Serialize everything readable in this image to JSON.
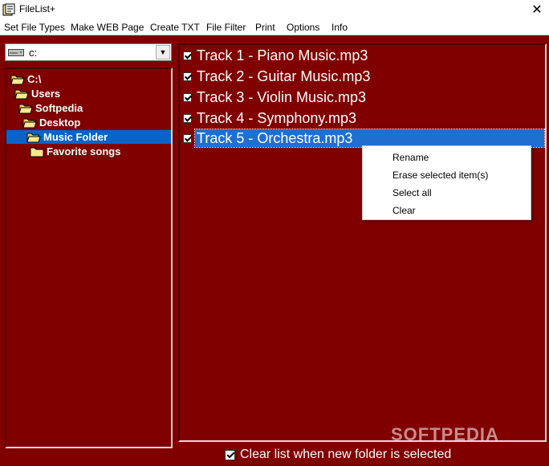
{
  "window": {
    "title": "FileList+"
  },
  "menu": {
    "items": [
      "Set File Types",
      "Make WEB Page",
      "Create TXT",
      "File Filter",
      "Print",
      "Options",
      "Info"
    ]
  },
  "drive": {
    "value": "c:"
  },
  "tree": {
    "nodes": [
      "C:\\",
      "Users",
      "Softpedia",
      "Desktop",
      "Music Folder",
      "Favorite songs"
    ],
    "selected": "Music Folder"
  },
  "files": [
    {
      "name": "Track 1 - Piano Music.mp3",
      "checked": true
    },
    {
      "name": "Track 2 - Guitar Music.mp3",
      "checked": true
    },
    {
      "name": "Track 3 - Violin Music.mp3",
      "checked": true
    },
    {
      "name": "Track 4 - Symphony.mp3",
      "checked": true
    },
    {
      "name": "Track 5 - Orchestra.mp3",
      "checked": true
    }
  ],
  "context_menu": {
    "items": [
      "Rename",
      "Erase selected item(s)",
      "Select all",
      "Clear"
    ]
  },
  "options": {
    "clear_list_label": "Clear list when new folder is selected",
    "clear_list_checked": true
  },
  "watermark": "SOFTPEDIA",
  "colors": {
    "background": "#800000",
    "selection": "#0a64c8"
  },
  "icons": [
    "app-icon",
    "close-icon",
    "drive-icon",
    "dropdown-arrow-icon",
    "folder-icon",
    "open-folder-icon",
    "checkbox-icon"
  ]
}
